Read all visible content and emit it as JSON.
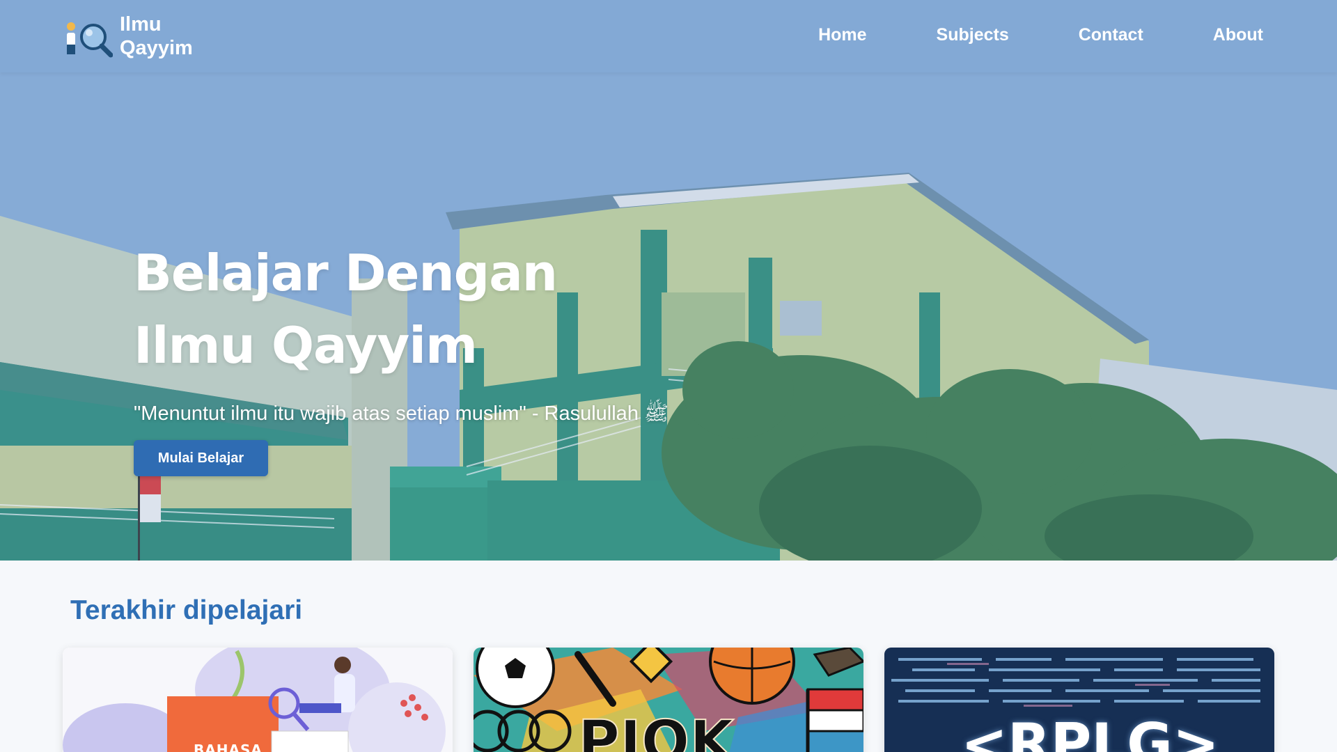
{
  "brand": {
    "name_line1": "Ilmu",
    "name_line2": "Qayyim",
    "logo_icon": "person-magnifier-icon"
  },
  "nav": {
    "items": [
      {
        "label": "Home"
      },
      {
        "label": "Subjects"
      },
      {
        "label": "Contact"
      },
      {
        "label": "About"
      }
    ]
  },
  "hero": {
    "title_line1": "Belajar Dengan",
    "title_line2": "Ilmu Qayyim",
    "quote": "\"Menuntut ilmu itu wajib atas setiap muslim\" - Rasulullah ﷺ",
    "cta_label": "Mulai Belajar"
  },
  "recent": {
    "title": "Terakhir dipelajari",
    "cards": [
      {
        "label": "BAHASA"
      },
      {
        "label": "PJOK"
      },
      {
        "label": "<RPLG>"
      }
    ]
  },
  "colors": {
    "accent": "#2f6cb3",
    "section_title": "#2f6fb5",
    "logo_yellow": "#f2b84b",
    "logo_navy": "#1f4f7a"
  }
}
